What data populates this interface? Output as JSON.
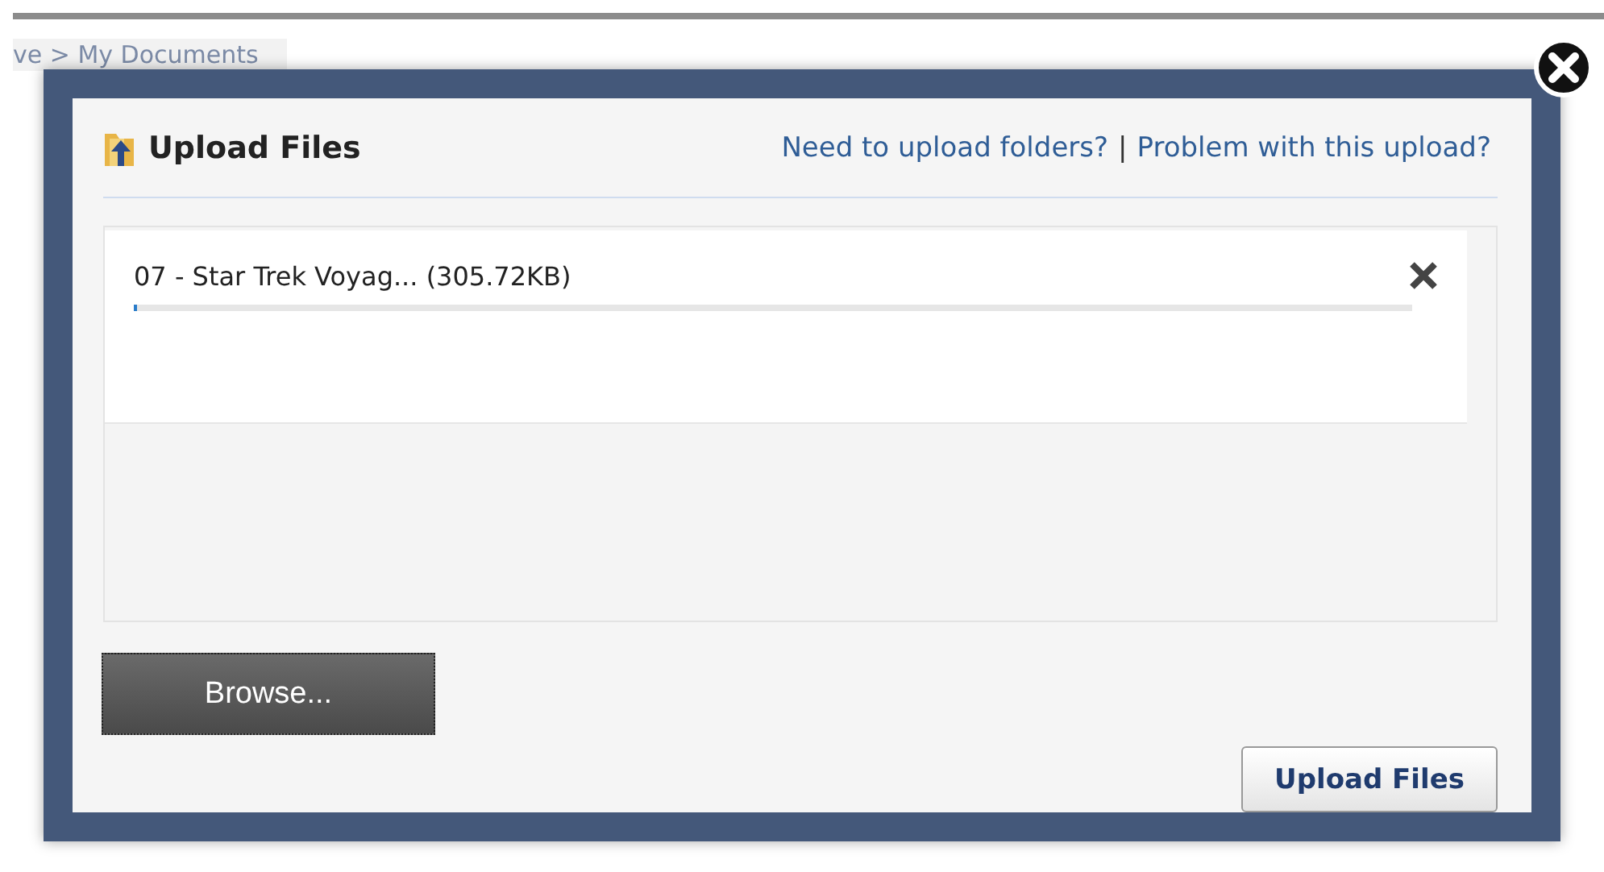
{
  "breadcrumb": "ve > My Documents",
  "dialog": {
    "title": "Upload Files",
    "links": [
      {
        "text": "Need to upload folders?"
      },
      {
        "text": "Problem with this upload?"
      }
    ],
    "separator": "|",
    "files": [
      {
        "name": "07 - Star Trek Voyag... (305.72KB)",
        "level": 0.003
      }
    ],
    "browse_button": "Browse...",
    "upload_button": "Upload Files"
  }
}
